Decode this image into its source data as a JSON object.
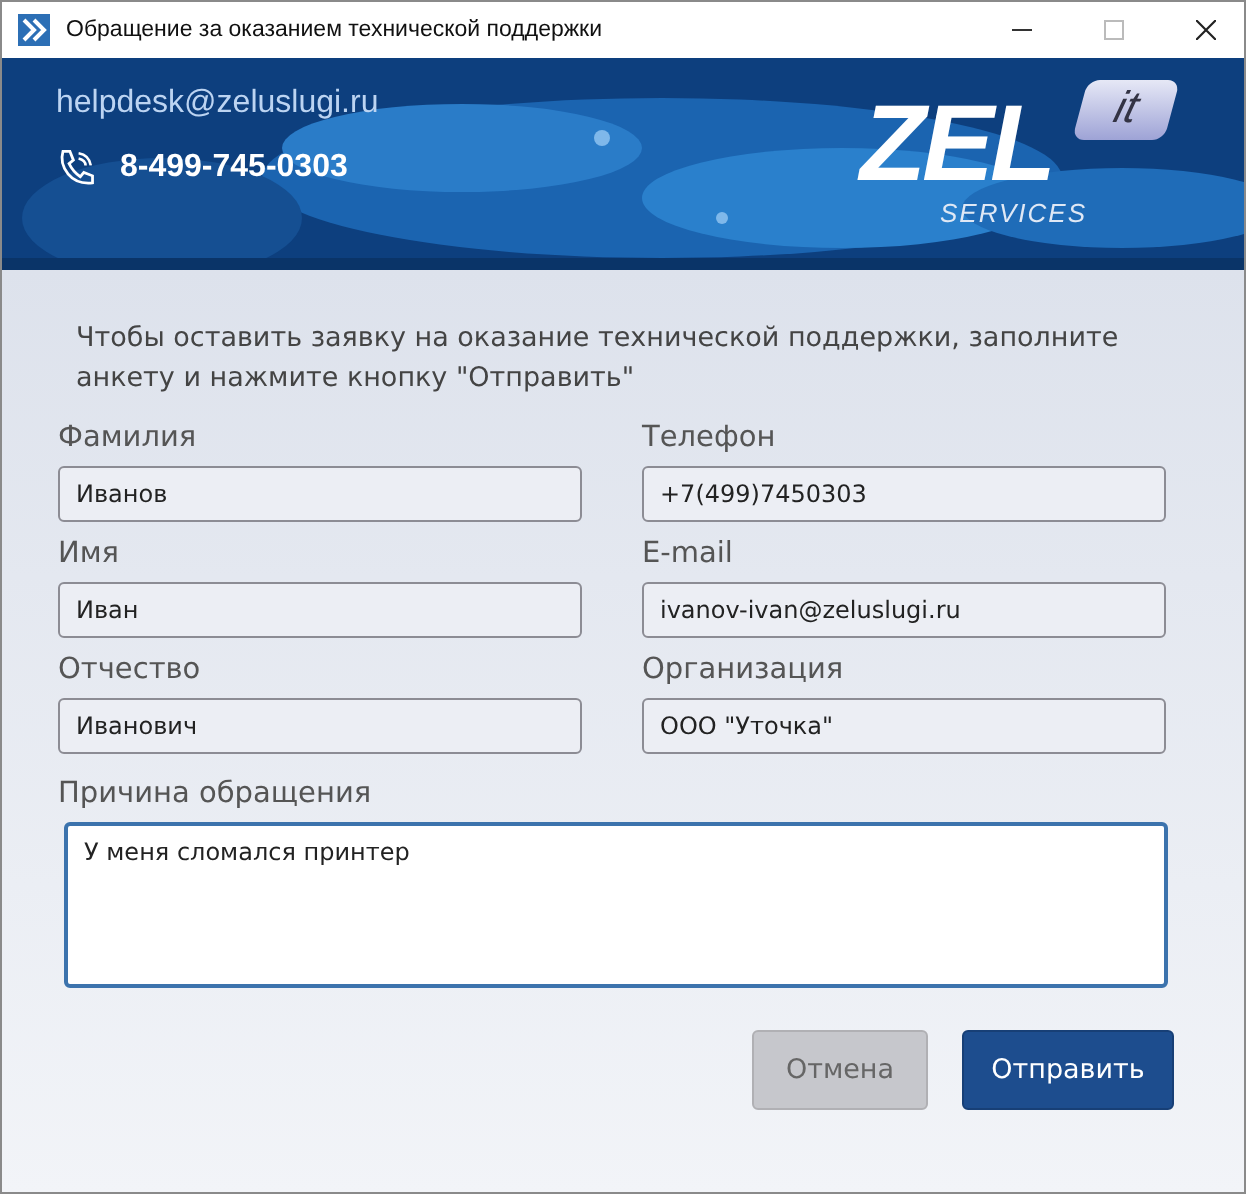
{
  "window": {
    "title": "Обращение за оказанием технической поддержки"
  },
  "banner": {
    "email": "helpdesk@zeluslugi.ru",
    "phone": "8-499-745-0303",
    "logo": {
      "main": "ZEL",
      "badge": "it",
      "sub": "SERVICES"
    }
  },
  "intro": "Чтобы оставить заявку на оказание технической поддержки, заполните анкету и нажмите кнопку \"Отправить\"",
  "fields": [
    {
      "label": "Фамилия",
      "value": "Иванов"
    },
    {
      "label": "Телефон",
      "value": "+7(499)7450303"
    },
    {
      "label": "Имя",
      "value": "Иван"
    },
    {
      "label": "E-mail",
      "value": "ivanov-ivan@zeluslugi.ru"
    },
    {
      "label": "Отчество",
      "value": "Иванович"
    },
    {
      "label": "Организация",
      "value": "ООО \"Уточка\""
    }
  ],
  "reason": {
    "label": "Причина обращения",
    "value": "У меня сломался принтер"
  },
  "buttons": [
    {
      "label": "Отмена",
      "kind": "secondary"
    },
    {
      "label": "Отправить",
      "kind": "primary"
    }
  ]
}
